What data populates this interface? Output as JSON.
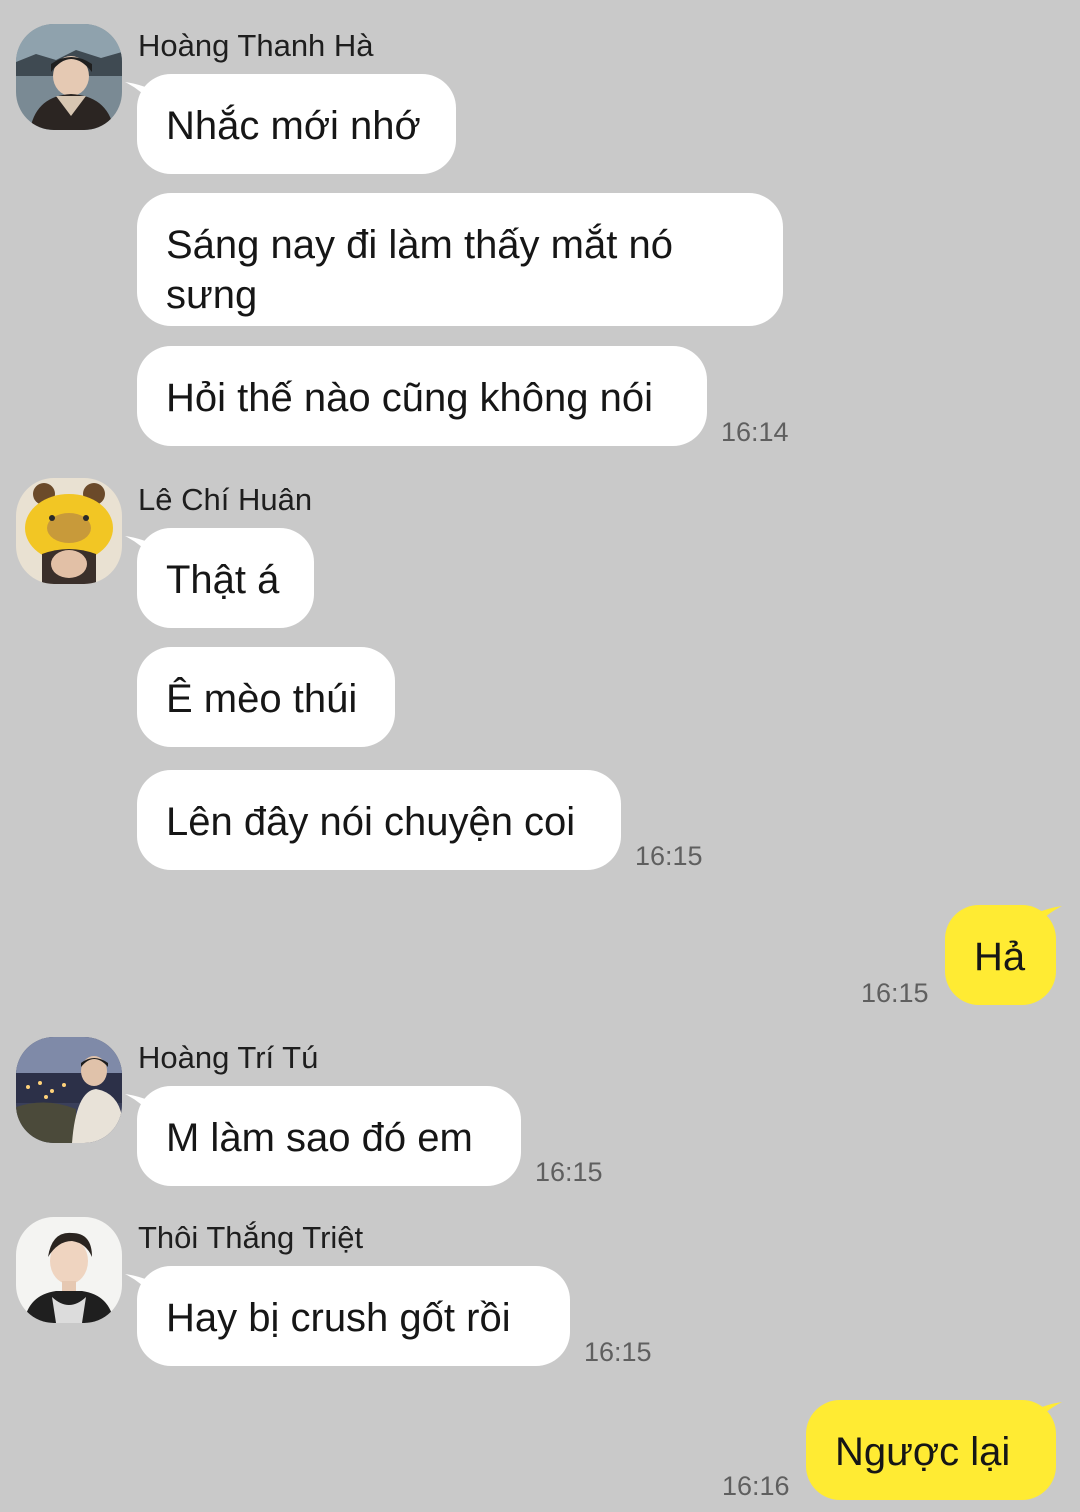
{
  "chat": {
    "groups": [
      {
        "sender": "Hoàng Thanh Hà",
        "avatar_icon": "avatar-photo-icon",
        "messages": [
          "Nhắc mới nhớ",
          "Sáng nay đi làm thấy mắt nó sưng",
          "Hỏi thế nào cũng không nói"
        ],
        "time": "16:14"
      },
      {
        "sender": "Lê Chí Huân",
        "avatar_icon": "avatar-photo-icon",
        "messages": [
          "Thật á",
          "Ê mèo thúi",
          "Lên đây nói chuyện coi"
        ],
        "time": "16:15"
      },
      {
        "sender": "Hoàng Trí Tú",
        "avatar_icon": "avatar-photo-icon",
        "messages": [
          "M làm sao đó em"
        ],
        "time": "16:15"
      },
      {
        "sender": "Thôi Thắng Triệt",
        "avatar_icon": "avatar-photo-icon",
        "messages": [
          "Hay bị crush gốt rồi"
        ],
        "time": "16:15"
      }
    ],
    "mine": [
      {
        "text": "Hả",
        "time": "16:15"
      },
      {
        "text": "Ngược lại",
        "time": "16:16"
      }
    ]
  },
  "colors": {
    "background": "#c9c9c9",
    "incoming_bubble": "#ffffff",
    "outgoing_bubble": "#ffeb33",
    "timestamp": "#5f5f5f"
  }
}
